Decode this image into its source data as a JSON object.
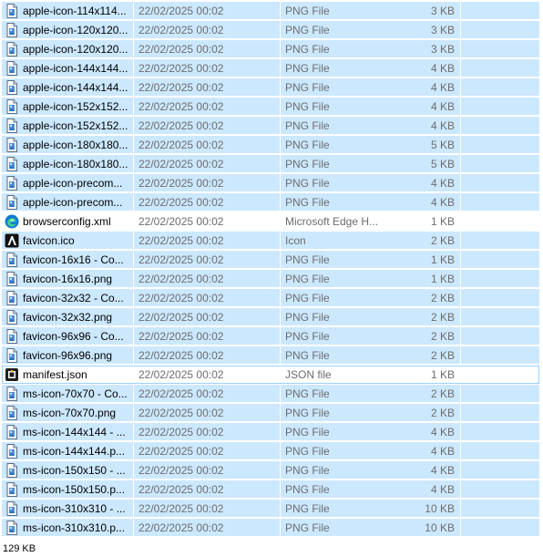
{
  "files": [
    {
      "name": "apple-icon-114x114...",
      "date": "22/02/2025 00:02",
      "type": "PNG File",
      "size": "3 KB",
      "icon": "png-file-icon",
      "state": "selected"
    },
    {
      "name": "apple-icon-120x120...",
      "date": "22/02/2025 00:02",
      "type": "PNG File",
      "size": "3 KB",
      "icon": "png-file-icon",
      "state": "selected"
    },
    {
      "name": "apple-icon-120x120...",
      "date": "22/02/2025 00:02",
      "type": "PNG File",
      "size": "3 KB",
      "icon": "png-file-icon",
      "state": "selected"
    },
    {
      "name": "apple-icon-144x144...",
      "date": "22/02/2025 00:02",
      "type": "PNG File",
      "size": "4 KB",
      "icon": "png-file-icon",
      "state": "selected"
    },
    {
      "name": "apple-icon-144x144...",
      "date": "22/02/2025 00:02",
      "type": "PNG File",
      "size": "4 KB",
      "icon": "png-file-icon",
      "state": "selected"
    },
    {
      "name": "apple-icon-152x152...",
      "date": "22/02/2025 00:02",
      "type": "PNG File",
      "size": "4 KB",
      "icon": "png-file-icon",
      "state": "selected"
    },
    {
      "name": "apple-icon-152x152...",
      "date": "22/02/2025 00:02",
      "type": "PNG File",
      "size": "4 KB",
      "icon": "png-file-icon",
      "state": "selected"
    },
    {
      "name": "apple-icon-180x180...",
      "date": "22/02/2025 00:02",
      "type": "PNG File",
      "size": "5 KB",
      "icon": "png-file-icon",
      "state": "selected"
    },
    {
      "name": "apple-icon-180x180...",
      "date": "22/02/2025 00:02",
      "type": "PNG File",
      "size": "5 KB",
      "icon": "png-file-icon",
      "state": "selected"
    },
    {
      "name": "apple-icon-precom...",
      "date": "22/02/2025 00:02",
      "type": "PNG File",
      "size": "4 KB",
      "icon": "png-file-icon",
      "state": "selected"
    },
    {
      "name": "apple-icon-precom...",
      "date": "22/02/2025 00:02",
      "type": "PNG File",
      "size": "4 KB",
      "icon": "png-file-icon",
      "state": "selected"
    },
    {
      "name": "browserconfig.xml",
      "date": "22/02/2025 00:02",
      "type": "Microsoft Edge H...",
      "size": "1 KB",
      "icon": "edge-icon",
      "state": "none"
    },
    {
      "name": "favicon.ico",
      "date": "22/02/2025 00:02",
      "type": "Icon",
      "size": "2 KB",
      "icon": "ico-file-icon",
      "state": "selected"
    },
    {
      "name": "favicon-16x16 - Co...",
      "date": "22/02/2025 00:02",
      "type": "PNG File",
      "size": "1 KB",
      "icon": "png-file-icon",
      "state": "selected"
    },
    {
      "name": "favicon-16x16.png",
      "date": "22/02/2025 00:02",
      "type": "PNG File",
      "size": "1 KB",
      "icon": "png-file-icon",
      "state": "selected"
    },
    {
      "name": "favicon-32x32 - Co...",
      "date": "22/02/2025 00:02",
      "type": "PNG File",
      "size": "2 KB",
      "icon": "png-file-icon",
      "state": "selected"
    },
    {
      "name": "favicon-32x32.png",
      "date": "22/02/2025 00:02",
      "type": "PNG File",
      "size": "2 KB",
      "icon": "png-file-icon",
      "state": "selected"
    },
    {
      "name": "favicon-96x96 - Co...",
      "date": "22/02/2025 00:02",
      "type": "PNG File",
      "size": "2 KB",
      "icon": "png-file-icon",
      "state": "selected"
    },
    {
      "name": "favicon-96x96.png",
      "date": "22/02/2025 00:02",
      "type": "PNG File",
      "size": "2 KB",
      "icon": "png-file-icon",
      "state": "selected"
    },
    {
      "name": "manifest.json",
      "date": "22/02/2025 00:02",
      "type": "JSON file",
      "size": "1 KB",
      "icon": "json-file-icon",
      "state": "focused"
    },
    {
      "name": "ms-icon-70x70 - Co...",
      "date": "22/02/2025 00:02",
      "type": "PNG File",
      "size": "2 KB",
      "icon": "png-file-icon",
      "state": "selected"
    },
    {
      "name": "ms-icon-70x70.png",
      "date": "22/02/2025 00:02",
      "type": "PNG File",
      "size": "2 KB",
      "icon": "png-file-icon",
      "state": "selected"
    },
    {
      "name": "ms-icon-144x144 - ...",
      "date": "22/02/2025 00:02",
      "type": "PNG File",
      "size": "4 KB",
      "icon": "png-file-icon",
      "state": "selected"
    },
    {
      "name": "ms-icon-144x144.p...",
      "date": "22/02/2025 00:02",
      "type": "PNG File",
      "size": "4 KB",
      "icon": "png-file-icon",
      "state": "selected"
    },
    {
      "name": "ms-icon-150x150 - ...",
      "date": "22/02/2025 00:02",
      "type": "PNG File",
      "size": "4 KB",
      "icon": "png-file-icon",
      "state": "selected"
    },
    {
      "name": "ms-icon-150x150.p...",
      "date": "22/02/2025 00:02",
      "type": "PNG File",
      "size": "4 KB",
      "icon": "png-file-icon",
      "state": "selected"
    },
    {
      "name": "ms-icon-310x310 - ...",
      "date": "22/02/2025 00:02",
      "type": "PNG File",
      "size": "10 KB",
      "icon": "png-file-icon",
      "state": "selected"
    },
    {
      "name": "ms-icon-310x310.p...",
      "date": "22/02/2025 00:02",
      "type": "PNG File",
      "size": "10 KB",
      "icon": "png-file-icon",
      "state": "selected"
    }
  ],
  "status": {
    "selection_size": "129 KB"
  },
  "colors": {
    "selection": "#cce8ff",
    "focus_border": "#99d1ff",
    "secondary_text": "#6d6d6d"
  }
}
